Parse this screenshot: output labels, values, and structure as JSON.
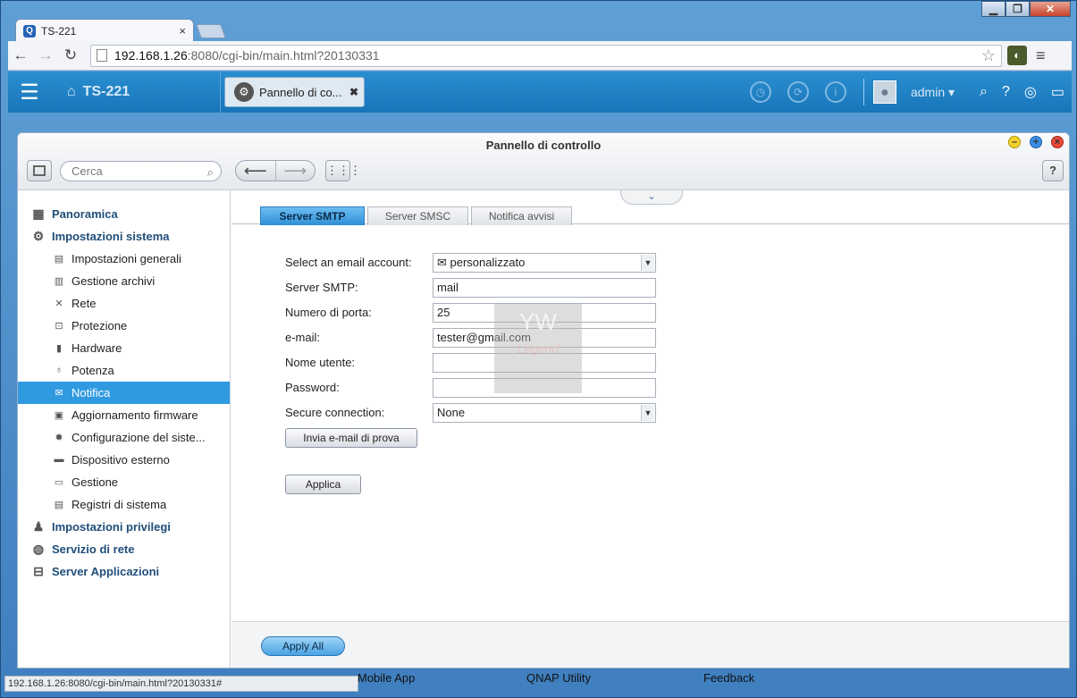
{
  "browser": {
    "tab_title": "TS-221",
    "tab_favicon": "Q",
    "tab_close": "×",
    "url_host": "192.168.1.26",
    "url_rest": ":8080/cgi-bin/main.html?20130331",
    "status_url": "192.168.1.26:8080/cgi-bin/main.html?20130331#"
  },
  "qnap_bar": {
    "home_label": "TS-221",
    "open_tab": "Pannello di co...",
    "user": "admin"
  },
  "desktop": {
    "items": [
      "Mobile App",
      "QNAP Utility",
      "Feedback"
    ]
  },
  "control_panel": {
    "title": "Pannello di controllo",
    "search_placeholder": "Cerca",
    "help": "?",
    "sidebar": {
      "groups": [
        {
          "label": "Panoramica"
        },
        {
          "label": "Impostazioni sistema"
        },
        {
          "label": "Impostazioni privilegi"
        },
        {
          "label": "Servizio di rete"
        },
        {
          "label": "Server Applicazioni"
        }
      ],
      "items": [
        {
          "label": "Impostazioni generali"
        },
        {
          "label": "Gestione archivi"
        },
        {
          "label": "Rete"
        },
        {
          "label": "Protezione"
        },
        {
          "label": "Hardware"
        },
        {
          "label": "Potenza"
        },
        {
          "label": "Notifica"
        },
        {
          "label": "Aggiornamento firmware"
        },
        {
          "label": "Configurazione del siste..."
        },
        {
          "label": "Dispositivo esterno"
        },
        {
          "label": "Gestione"
        },
        {
          "label": "Registri di sistema"
        }
      ]
    },
    "tabs": [
      {
        "label": "Server SMTP"
      },
      {
        "label": "Server SMSC"
      },
      {
        "label": "Notifica avvisi"
      }
    ],
    "form": {
      "account_label": "Select an email account:",
      "account_value": "personalizzato",
      "smtp_label": "Server SMTP:",
      "smtp_value": "mail",
      "port_label": "Numero di porta:",
      "port_value": "25",
      "email_label": "e-mail:",
      "email_value": "tester@gmail.com",
      "user_label": "Nome utente:",
      "user_value": "",
      "password_label": "Password:",
      "password_value": "",
      "secure_label": "Secure connection:",
      "secure_value": "None",
      "test_button": "Invia e-mail di prova",
      "apply_button": "Applica"
    },
    "apply_all": "Apply All"
  }
}
